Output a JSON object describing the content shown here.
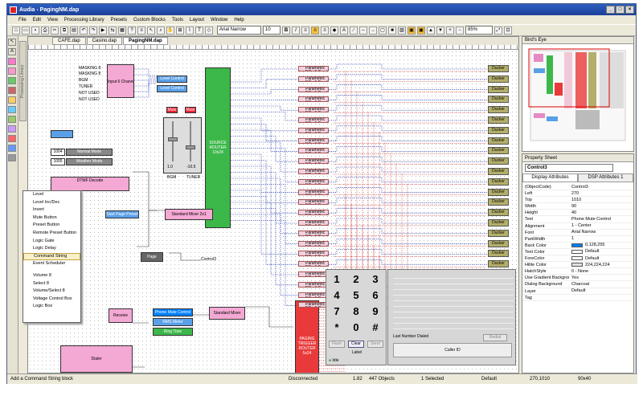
{
  "window": {
    "title": "Audia - PagingNM.dap"
  },
  "menu": [
    "File",
    "Edit",
    "View",
    "Processing Library",
    "Presets",
    "Custom Blocks",
    "Tools",
    "Layout",
    "Window",
    "Help"
  ],
  "toolbar": {
    "font": "Arial Narrow",
    "size": "10",
    "zoom": "85%"
  },
  "side_tab": "Processing Library",
  "doc_tabs": [
    "CAFE.dap",
    "Casino.dap",
    "PagingNM.dap"
  ],
  "canvas": {
    "inputs": [
      "MASKING 8",
      "MASKING 8",
      "BGM",
      "TUNER",
      "NOT USED",
      "NOT USED"
    ],
    "input_block": "Input 6 Channel",
    "level_control": "Level Control",
    "mute": "Mute",
    "fader_values": [
      "1.0",
      "-10.5"
    ],
    "fader_labels": [
      "BGM",
      "TUNER"
    ],
    "source_router": "SOURCE ROUTER",
    "source_router_size": "10x24",
    "preset_a": "1004",
    "preset_a_label": "Normal Mode",
    "preset_b": "1005",
    "preset_b_label": "Weather Mode",
    "dtmf": "DTMF Decode",
    "preset_btn": "Start Page Preset",
    "mixer": "Standard Mixer",
    "mixer_size": "2x1",
    "page": "Page",
    "control": "Control3",
    "receive": "Receive",
    "phone_mute": "Phone Mute Control",
    "rm_meter": "RMS Meter",
    "ring": "Ring Tone",
    "dialer": "Dialer",
    "paging_router": "PAGING TRIGGER ROUTER",
    "paging_router_size": "5x24",
    "peq": "Parametric EQ - 1 Band",
    "ducker": "Ducker"
  },
  "context_menu": [
    "Level",
    "Level Inc/Dec",
    "Invert",
    "Mute Button",
    "Preset Button",
    "Remote Preset Button",
    "Logic Gate",
    "Logic Delay",
    "Command String",
    "Event Scheduler",
    "",
    "Volume 8",
    "Select 8",
    "Volume/Select 8",
    "Voltage Control Box",
    "Logic Box"
  ],
  "keypad": {
    "keys": [
      "1",
      "2",
      "3",
      "4",
      "5",
      "6",
      "7",
      "8",
      "9",
      "*",
      "0",
      "#"
    ],
    "buttons": [
      "Flash",
      "Clear",
      "Send"
    ],
    "label": "Label",
    "idle": "Idle"
  },
  "dial_panel": {
    "last_number": "Last Number Dialed",
    "redial": "Redial",
    "caller_id": "Caller ID"
  },
  "birds_eye": {
    "title": "Bird's Eye"
  },
  "property_sheet": {
    "title": "Property Sheet",
    "object": "Control3",
    "tabs": [
      "Display Attributes",
      "DSP Attributes 1"
    ],
    "rows": [
      {
        "name": "(ObjectCode)",
        "value": "Control3"
      },
      {
        "name": "Left",
        "value": "270"
      },
      {
        "name": "Top",
        "value": "1010"
      },
      {
        "name": "Width",
        "value": "90"
      },
      {
        "name": "Height",
        "value": "40"
      },
      {
        "name": "Text",
        "value": "Phone Mute Control"
      },
      {
        "name": "Alignment",
        "value": "1 - Center"
      },
      {
        "name": "Font",
        "value": "Arial Narrow"
      },
      {
        "name": "ParkWidth",
        "value": "1"
      },
      {
        "name": "Back Color",
        "value": "0,128,255",
        "swatch": "#0080ff"
      },
      {
        "name": "Text Color",
        "value": "Default",
        "swatch": "#ffffff"
      },
      {
        "name": "ForeColor",
        "value": "Default",
        "swatch": "#ffffff"
      },
      {
        "name": "Hilite Color",
        "value": "224,224,224",
        "swatch": "#e0e0e0"
      },
      {
        "name": "HatchStyle",
        "value": "0 - None"
      },
      {
        "name": "Use Gradient Background",
        "value": "Yes"
      },
      {
        "name": "Dialog Background",
        "value": "Charcoal"
      },
      {
        "name": "Layer",
        "value": "Default"
      },
      {
        "name": "Tag",
        "value": ""
      }
    ]
  },
  "status": {
    "hint": "Add a Command String block",
    "connection": "Disconnected",
    "version": "1.82",
    "objects": "447 Objects",
    "selected": "1 Selected",
    "mode": "Default",
    "coords": "270,1010",
    "size": "90x40"
  }
}
